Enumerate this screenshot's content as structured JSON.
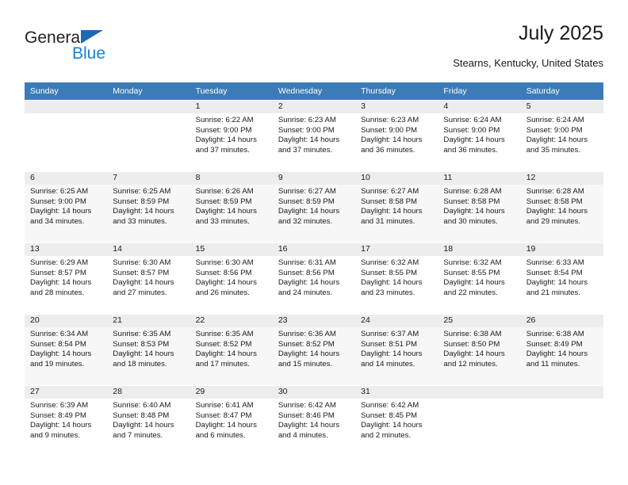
{
  "brand": {
    "name_part1": "General",
    "name_part2": "Blue",
    "triangle_color": "#1a6bb5",
    "blue_color": "#1a7fd4"
  },
  "header": {
    "title": "July 2025",
    "subtitle": "Stearns, Kentucky, United States"
  },
  "theme": {
    "header_bg": "#3b7cb8",
    "header_text": "#ffffff",
    "row_alt_bg": "#f7f7f7",
    "daynum_band_bg": "#ededed"
  },
  "calendar": {
    "weekday_headers": [
      "Sunday",
      "Monday",
      "Tuesday",
      "Wednesday",
      "Thursday",
      "Friday",
      "Saturday"
    ],
    "weeks": [
      [
        {
          "day": "",
          "lines": []
        },
        {
          "day": "",
          "lines": []
        },
        {
          "day": "1",
          "lines": [
            "Sunrise: 6:22 AM",
            "Sunset: 9:00 PM",
            "Daylight: 14 hours",
            "and 37 minutes."
          ]
        },
        {
          "day": "2",
          "lines": [
            "Sunrise: 6:23 AM",
            "Sunset: 9:00 PM",
            "Daylight: 14 hours",
            "and 37 minutes."
          ]
        },
        {
          "day": "3",
          "lines": [
            "Sunrise: 6:23 AM",
            "Sunset: 9:00 PM",
            "Daylight: 14 hours",
            "and 36 minutes."
          ]
        },
        {
          "day": "4",
          "lines": [
            "Sunrise: 6:24 AM",
            "Sunset: 9:00 PM",
            "Daylight: 14 hours",
            "and 36 minutes."
          ]
        },
        {
          "day": "5",
          "lines": [
            "Sunrise: 6:24 AM",
            "Sunset: 9:00 PM",
            "Daylight: 14 hours",
            "and 35 minutes."
          ]
        }
      ],
      [
        {
          "day": "6",
          "lines": [
            "Sunrise: 6:25 AM",
            "Sunset: 9:00 PM",
            "Daylight: 14 hours",
            "and 34 minutes."
          ]
        },
        {
          "day": "7",
          "lines": [
            "Sunrise: 6:25 AM",
            "Sunset: 8:59 PM",
            "Daylight: 14 hours",
            "and 33 minutes."
          ]
        },
        {
          "day": "8",
          "lines": [
            "Sunrise: 6:26 AM",
            "Sunset: 8:59 PM",
            "Daylight: 14 hours",
            "and 33 minutes."
          ]
        },
        {
          "day": "9",
          "lines": [
            "Sunrise: 6:27 AM",
            "Sunset: 8:59 PM",
            "Daylight: 14 hours",
            "and 32 minutes."
          ]
        },
        {
          "day": "10",
          "lines": [
            "Sunrise: 6:27 AM",
            "Sunset: 8:58 PM",
            "Daylight: 14 hours",
            "and 31 minutes."
          ]
        },
        {
          "day": "11",
          "lines": [
            "Sunrise: 6:28 AM",
            "Sunset: 8:58 PM",
            "Daylight: 14 hours",
            "and 30 minutes."
          ]
        },
        {
          "day": "12",
          "lines": [
            "Sunrise: 6:28 AM",
            "Sunset: 8:58 PM",
            "Daylight: 14 hours",
            "and 29 minutes."
          ]
        }
      ],
      [
        {
          "day": "13",
          "lines": [
            "Sunrise: 6:29 AM",
            "Sunset: 8:57 PM",
            "Daylight: 14 hours",
            "and 28 minutes."
          ]
        },
        {
          "day": "14",
          "lines": [
            "Sunrise: 6:30 AM",
            "Sunset: 8:57 PM",
            "Daylight: 14 hours",
            "and 27 minutes."
          ]
        },
        {
          "day": "15",
          "lines": [
            "Sunrise: 6:30 AM",
            "Sunset: 8:56 PM",
            "Daylight: 14 hours",
            "and 26 minutes."
          ]
        },
        {
          "day": "16",
          "lines": [
            "Sunrise: 6:31 AM",
            "Sunset: 8:56 PM",
            "Daylight: 14 hours",
            "and 24 minutes."
          ]
        },
        {
          "day": "17",
          "lines": [
            "Sunrise: 6:32 AM",
            "Sunset: 8:55 PM",
            "Daylight: 14 hours",
            "and 23 minutes."
          ]
        },
        {
          "day": "18",
          "lines": [
            "Sunrise: 6:32 AM",
            "Sunset: 8:55 PM",
            "Daylight: 14 hours",
            "and 22 minutes."
          ]
        },
        {
          "day": "19",
          "lines": [
            "Sunrise: 6:33 AM",
            "Sunset: 8:54 PM",
            "Daylight: 14 hours",
            "and 21 minutes."
          ]
        }
      ],
      [
        {
          "day": "20",
          "lines": [
            "Sunrise: 6:34 AM",
            "Sunset: 8:54 PM",
            "Daylight: 14 hours",
            "and 19 minutes."
          ]
        },
        {
          "day": "21",
          "lines": [
            "Sunrise: 6:35 AM",
            "Sunset: 8:53 PM",
            "Daylight: 14 hours",
            "and 18 minutes."
          ]
        },
        {
          "day": "22",
          "lines": [
            "Sunrise: 6:35 AM",
            "Sunset: 8:52 PM",
            "Daylight: 14 hours",
            "and 17 minutes."
          ]
        },
        {
          "day": "23",
          "lines": [
            "Sunrise: 6:36 AM",
            "Sunset: 8:52 PM",
            "Daylight: 14 hours",
            "and 15 minutes."
          ]
        },
        {
          "day": "24",
          "lines": [
            "Sunrise: 6:37 AM",
            "Sunset: 8:51 PM",
            "Daylight: 14 hours",
            "and 14 minutes."
          ]
        },
        {
          "day": "25",
          "lines": [
            "Sunrise: 6:38 AM",
            "Sunset: 8:50 PM",
            "Daylight: 14 hours",
            "and 12 minutes."
          ]
        },
        {
          "day": "26",
          "lines": [
            "Sunrise: 6:38 AM",
            "Sunset: 8:49 PM",
            "Daylight: 14 hours",
            "and 11 minutes."
          ]
        }
      ],
      [
        {
          "day": "27",
          "lines": [
            "Sunrise: 6:39 AM",
            "Sunset: 8:49 PM",
            "Daylight: 14 hours",
            "and 9 minutes."
          ]
        },
        {
          "day": "28",
          "lines": [
            "Sunrise: 6:40 AM",
            "Sunset: 8:48 PM",
            "Daylight: 14 hours",
            "and 7 minutes."
          ]
        },
        {
          "day": "29",
          "lines": [
            "Sunrise: 6:41 AM",
            "Sunset: 8:47 PM",
            "Daylight: 14 hours",
            "and 6 minutes."
          ]
        },
        {
          "day": "30",
          "lines": [
            "Sunrise: 6:42 AM",
            "Sunset: 8:46 PM",
            "Daylight: 14 hours",
            "and 4 minutes."
          ]
        },
        {
          "day": "31",
          "lines": [
            "Sunrise: 6:42 AM",
            "Sunset: 8:45 PM",
            "Daylight: 14 hours",
            "and 2 minutes."
          ]
        },
        {
          "day": "",
          "lines": []
        },
        {
          "day": "",
          "lines": []
        }
      ]
    ]
  }
}
